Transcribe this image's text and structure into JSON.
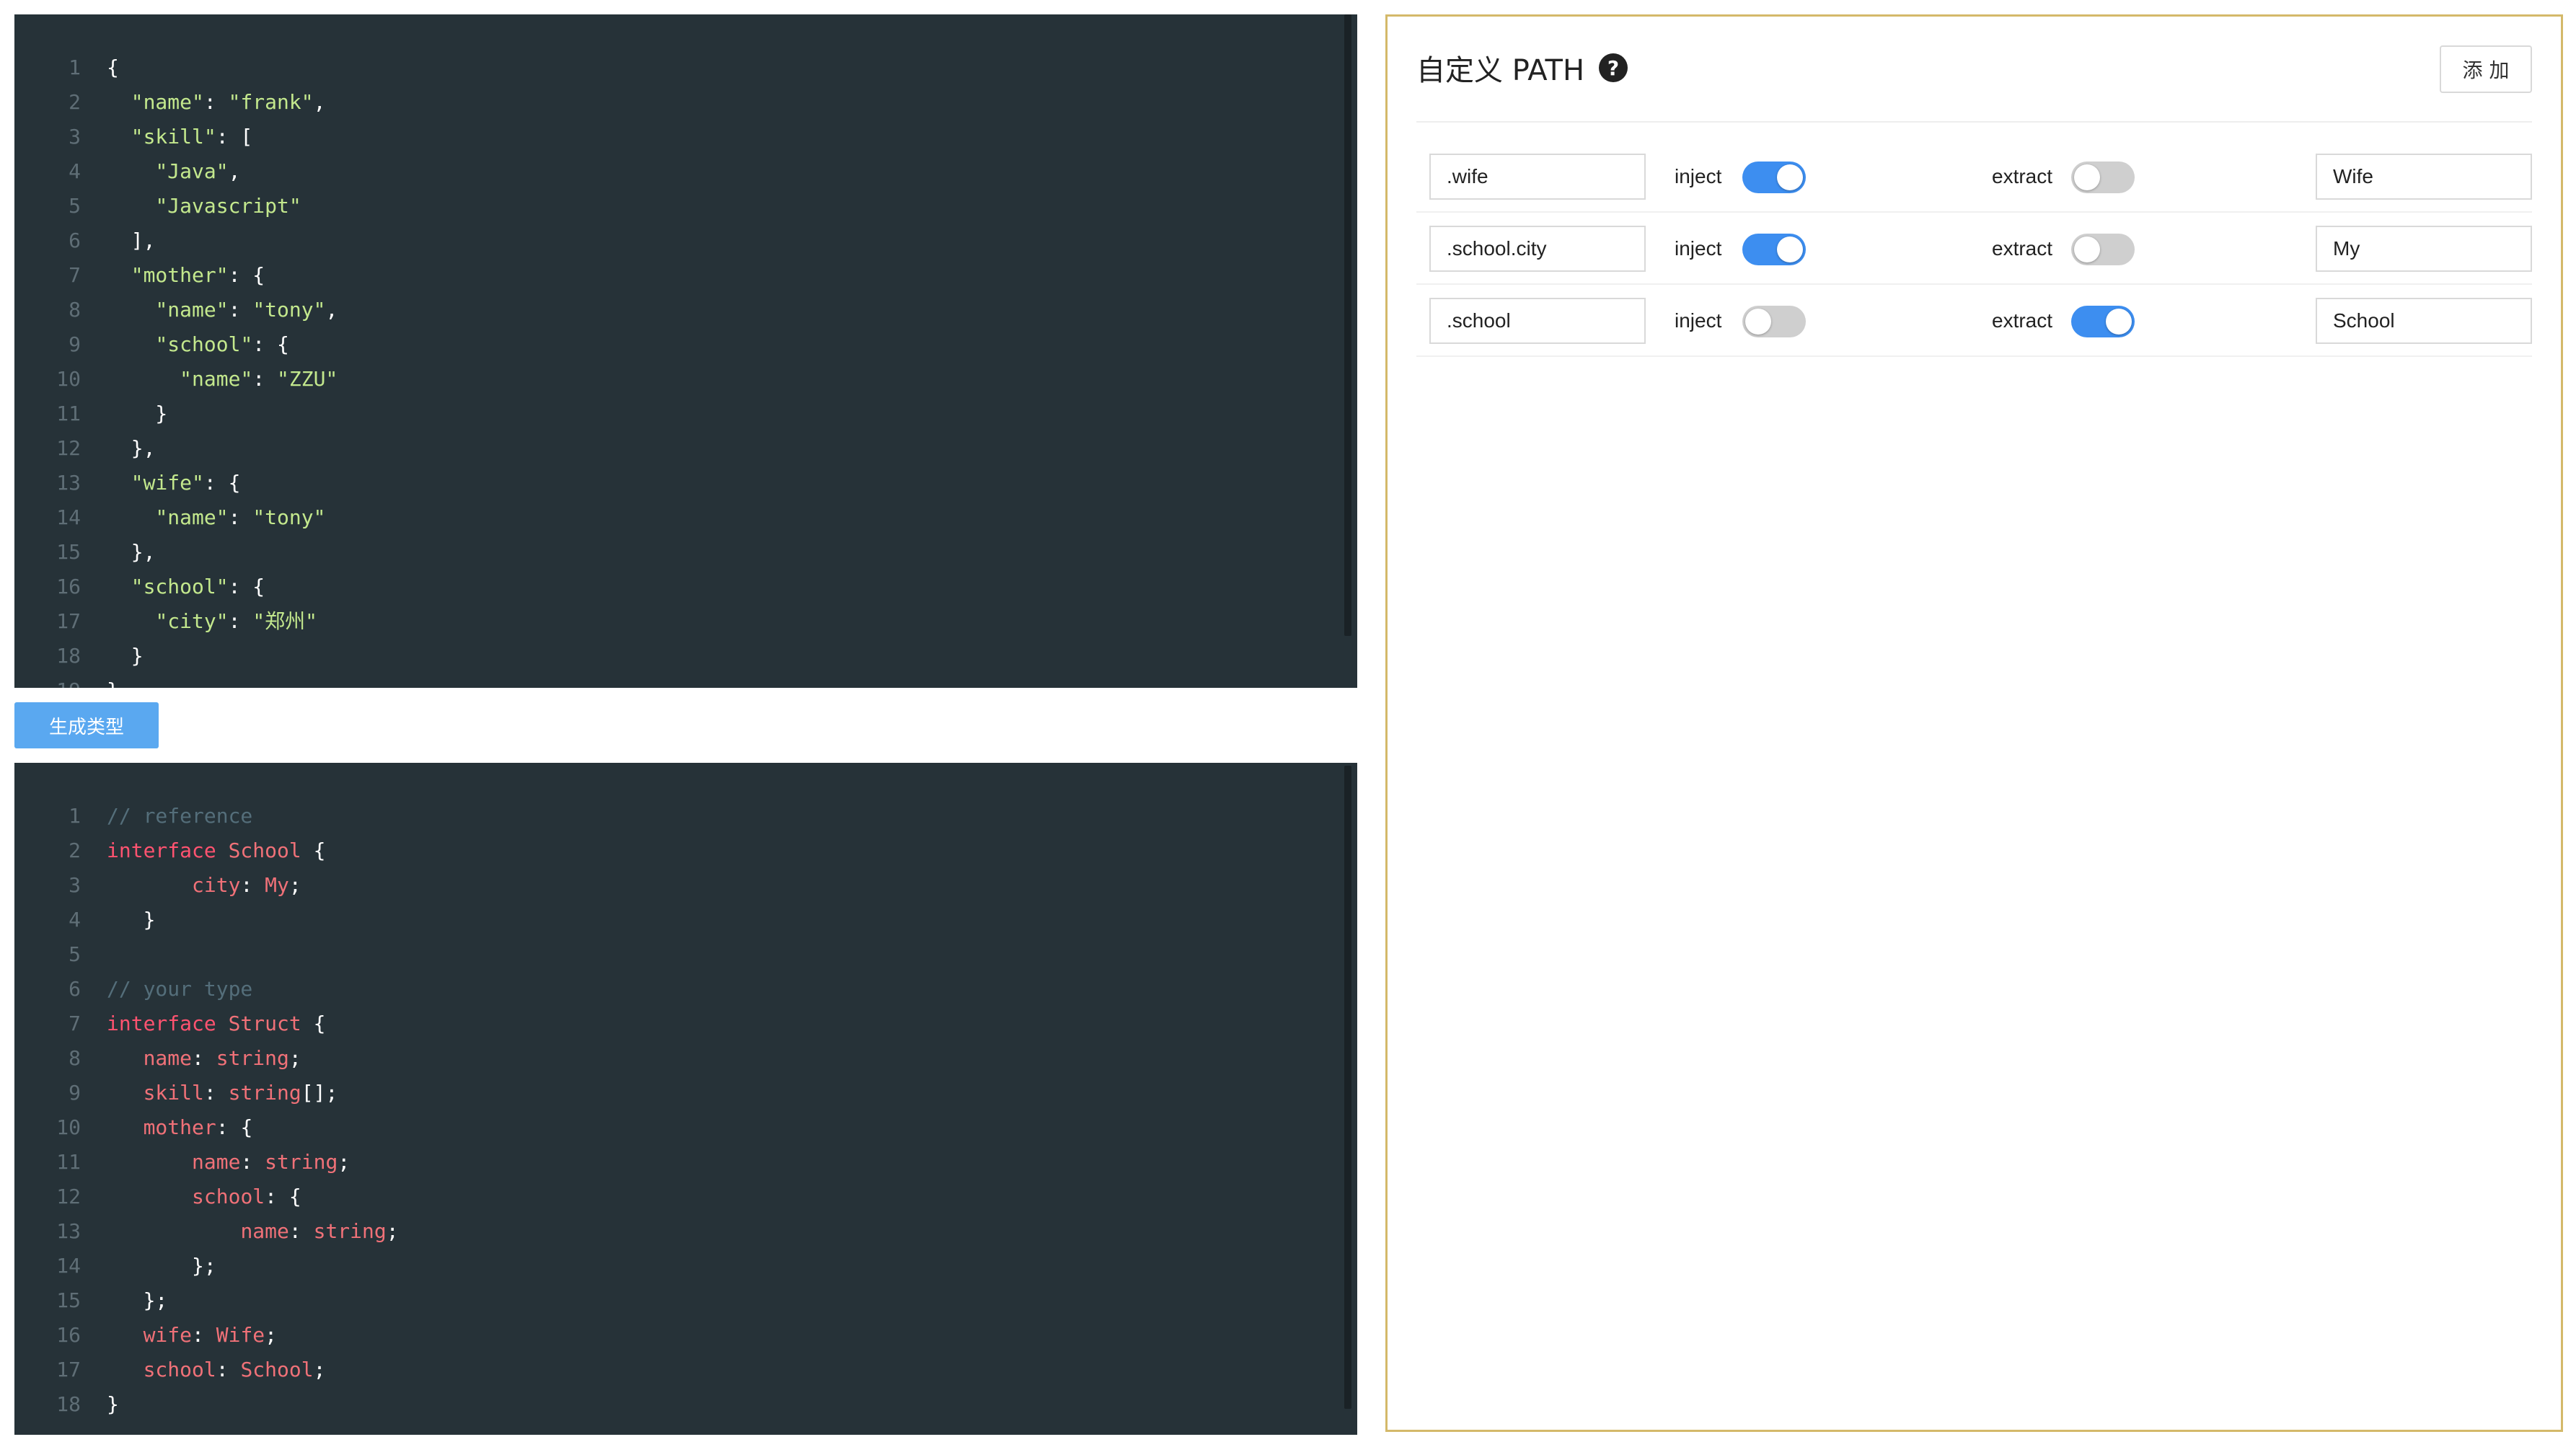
{
  "editor_top": {
    "lines": [
      [
        [
          "punc",
          "{"
        ]
      ],
      [
        [
          "punc",
          "  "
        ],
        [
          "str",
          "\"name\""
        ],
        [
          "punc",
          ": "
        ],
        [
          "str",
          "\"frank\""
        ],
        [
          "punc",
          ","
        ]
      ],
      [
        [
          "punc",
          "  "
        ],
        [
          "str",
          "\"skill\""
        ],
        [
          "punc",
          ": ["
        ]
      ],
      [
        [
          "punc",
          "    "
        ],
        [
          "str",
          "\"Java\""
        ],
        [
          "punc",
          ","
        ]
      ],
      [
        [
          "punc",
          "    "
        ],
        [
          "str",
          "\"Javascript\""
        ]
      ],
      [
        [
          "punc",
          "  ],"
        ]
      ],
      [
        [
          "punc",
          "  "
        ],
        [
          "str",
          "\"mother\""
        ],
        [
          "punc",
          ": {"
        ]
      ],
      [
        [
          "punc",
          "    "
        ],
        [
          "str",
          "\"name\""
        ],
        [
          "punc",
          ": "
        ],
        [
          "str",
          "\"tony\""
        ],
        [
          "punc",
          ","
        ]
      ],
      [
        [
          "punc",
          "    "
        ],
        [
          "str",
          "\"school\""
        ],
        [
          "punc",
          ": {"
        ]
      ],
      [
        [
          "punc",
          "      "
        ],
        [
          "str",
          "\"name\""
        ],
        [
          "punc",
          ": "
        ],
        [
          "str",
          "\"ZZU\""
        ]
      ],
      [
        [
          "punc",
          "    }"
        ]
      ],
      [
        [
          "punc",
          "  },"
        ]
      ],
      [
        [
          "punc",
          "  "
        ],
        [
          "str",
          "\"wife\""
        ],
        [
          "punc",
          ": {"
        ]
      ],
      [
        [
          "punc",
          "    "
        ],
        [
          "str",
          "\"name\""
        ],
        [
          "punc",
          ": "
        ],
        [
          "str",
          "\"tony\""
        ]
      ],
      [
        [
          "punc",
          "  },"
        ]
      ],
      [
        [
          "punc",
          "  "
        ],
        [
          "str",
          "\"school\""
        ],
        [
          "punc",
          ": {"
        ]
      ],
      [
        [
          "punc",
          "    "
        ],
        [
          "str",
          "\"city\""
        ],
        [
          "punc",
          ": "
        ],
        [
          "str",
          "\"郑州\""
        ]
      ],
      [
        [
          "punc",
          "  }"
        ]
      ],
      [
        [
          "punc",
          "}"
        ]
      ]
    ]
  },
  "generate_button": {
    "label": "生成类型"
  },
  "editor_bottom": {
    "lines": [
      [
        [
          "comment",
          "// reference"
        ]
      ],
      [
        [
          "kw",
          "interface"
        ],
        [
          "punc",
          " "
        ],
        [
          "type",
          "School"
        ],
        [
          "punc",
          " {"
        ]
      ],
      [
        [
          "punc",
          "       "
        ],
        [
          "prop",
          "city"
        ],
        [
          "punc",
          ": "
        ],
        [
          "type",
          "My"
        ],
        [
          "punc",
          ";"
        ]
      ],
      [
        [
          "punc",
          "   }"
        ]
      ],
      [
        [
          "punc",
          ""
        ]
      ],
      [
        [
          "comment",
          "// your type"
        ]
      ],
      [
        [
          "kw",
          "interface"
        ],
        [
          "punc",
          " "
        ],
        [
          "type",
          "Struct"
        ],
        [
          "punc",
          " {"
        ]
      ],
      [
        [
          "punc",
          "   "
        ],
        [
          "prop",
          "name"
        ],
        [
          "punc",
          ": "
        ],
        [
          "type",
          "string"
        ],
        [
          "punc",
          ";"
        ]
      ],
      [
        [
          "punc",
          "   "
        ],
        [
          "prop",
          "skill"
        ],
        [
          "punc",
          ": "
        ],
        [
          "type",
          "string"
        ],
        [
          "punc",
          "[];"
        ]
      ],
      [
        [
          "punc",
          "   "
        ],
        [
          "prop",
          "mother"
        ],
        [
          "punc",
          ": {"
        ]
      ],
      [
        [
          "punc",
          "       "
        ],
        [
          "prop",
          "name"
        ],
        [
          "punc",
          ": "
        ],
        [
          "type",
          "string"
        ],
        [
          "punc",
          ";"
        ]
      ],
      [
        [
          "punc",
          "       "
        ],
        [
          "prop",
          "school"
        ],
        [
          "punc",
          ": {"
        ]
      ],
      [
        [
          "punc",
          "           "
        ],
        [
          "prop",
          "name"
        ],
        [
          "punc",
          ": "
        ],
        [
          "type",
          "string"
        ],
        [
          "punc",
          ";"
        ]
      ],
      [
        [
          "punc",
          "       };"
        ]
      ],
      [
        [
          "punc",
          "   };"
        ]
      ],
      [
        [
          "punc",
          "   "
        ],
        [
          "prop",
          "wife"
        ],
        [
          "punc",
          ": "
        ],
        [
          "type",
          "Wife"
        ],
        [
          "punc",
          ";"
        ]
      ],
      [
        [
          "punc",
          "   "
        ],
        [
          "prop",
          "school"
        ],
        [
          "punc",
          ": "
        ],
        [
          "type",
          "School"
        ],
        [
          "punc",
          ";"
        ]
      ],
      [
        [
          "punc",
          "}"
        ]
      ]
    ]
  },
  "panel": {
    "title": "自定义 PATH",
    "help_glyph": "?",
    "add_label": "添 加",
    "inject_label": "inject",
    "extract_label": "extract",
    "rows": [
      {
        "path": ".wife",
        "inject": true,
        "extract": false,
        "type_name": "Wife"
      },
      {
        "path": ".school.city",
        "inject": true,
        "extract": false,
        "type_name": "My"
      },
      {
        "path": ".school",
        "inject": false,
        "extract": true,
        "type_name": "School"
      }
    ]
  }
}
